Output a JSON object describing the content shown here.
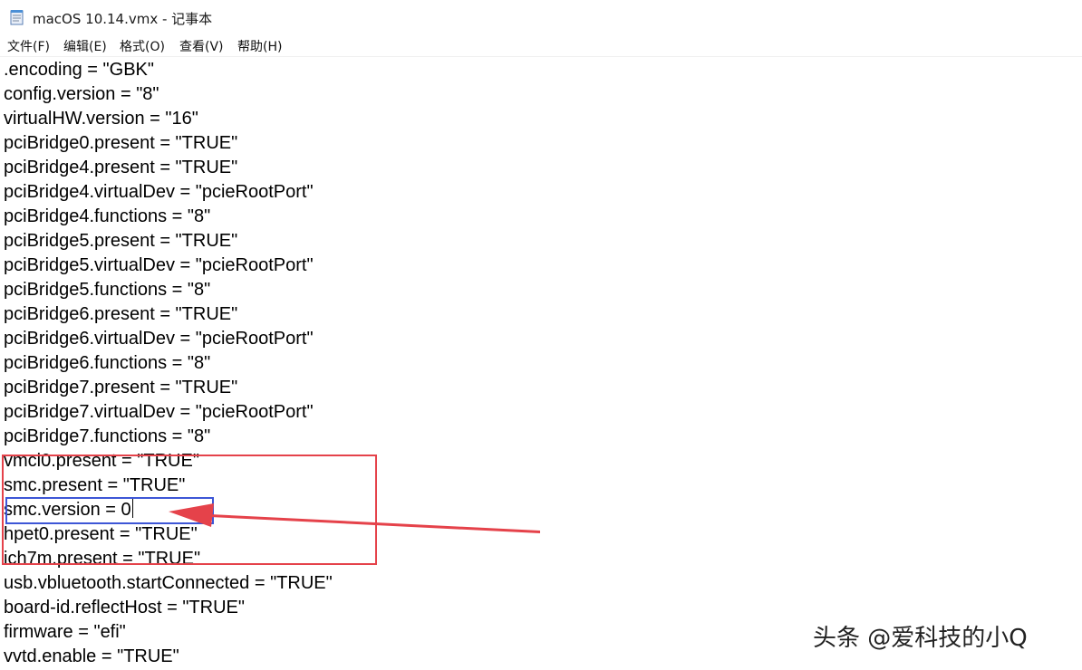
{
  "window": {
    "title": "macOS 10.14.vmx - 记事本",
    "icon": "notepad-icon"
  },
  "menu": [
    {
      "label": "文件(F)"
    },
    {
      "label": "编辑(E)"
    },
    {
      "label": "格式(O)"
    },
    {
      "label": "查看(V)"
    },
    {
      "label": "帮助(H)"
    }
  ],
  "editor": {
    "lines": [
      ".encoding = \"GBK\"",
      "config.version = \"8\"",
      "virtualHW.version = \"16\"",
      "pciBridge0.present = \"TRUE\"",
      "pciBridge4.present = \"TRUE\"",
      "pciBridge4.virtualDev = \"pcieRootPort\"",
      "pciBridge4.functions = \"8\"",
      "pciBridge5.present = \"TRUE\"",
      "pciBridge5.virtualDev = \"pcieRootPort\"",
      "pciBridge5.functions = \"8\"",
      "pciBridge6.present = \"TRUE\"",
      "pciBridge6.virtualDev = \"pcieRootPort\"",
      "pciBridge6.functions = \"8\"",
      "pciBridge7.present = \"TRUE\"",
      "pciBridge7.virtualDev = \"pcieRootPort\"",
      "pciBridge7.functions = \"8\"",
      "vmci0.present = \"TRUE\"",
      "smc.present = \"TRUE\"",
      "smc.version = 0",
      "hpet0.present = \"TRUE\"",
      "ich7m.present = \"TRUE\"",
      "usb.vbluetooth.startConnected = \"TRUE\"",
      "board-id.reflectHost = \"TRUE\"",
      "firmware = \"efi\"",
      "vvtd.enable = \"TRUE\""
    ]
  },
  "annotations": {
    "red_box_color": "#e5424a",
    "blue_box_color": "#3d56d6",
    "arrow_color": "#e5424a"
  },
  "watermark": {
    "text": "头条 @爱科技的小Q"
  }
}
